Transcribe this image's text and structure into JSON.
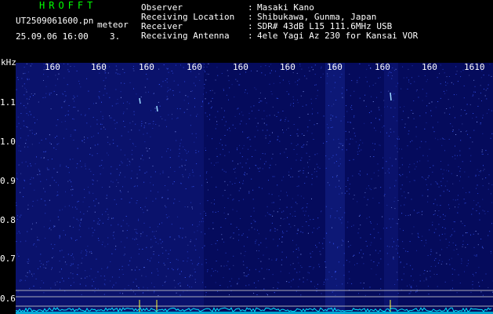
{
  "header": {
    "app_title": "HROFFT",
    "file_name": "UT2509061600.pn",
    "meteor_label": "meteor",
    "date_time": "25.09.06 16:00",
    "count": "3."
  },
  "info": [
    {
      "label": "Observer",
      "value": "Masaki Kano"
    },
    {
      "label": "Receiving Location",
      "value": "Shibukawa, Gunma, Japan"
    },
    {
      "label": "Receiver",
      "value": "SDR# 43dB L15 111.6MHz USB"
    },
    {
      "label": "Receiving Antenna",
      "value": "4ele Yagi Az 230 for Kansai VOR"
    }
  ],
  "info_separator": ":",
  "chart_data": {
    "type": "heatmap",
    "ylabel": "kHz",
    "y_ticks": [
      "1.1",
      "1.0",
      "0.9",
      "0.8",
      "0.7",
      "0.6"
    ],
    "x_ticks": [
      "160",
      "160",
      "160",
      "160",
      "160",
      "160",
      "160",
      "160",
      "160",
      "1610"
    ],
    "background_color": "#050b5c",
    "noise_color": "#3a5cff",
    "trace_color": "#00e5ff",
    "reference_line_color": "#c8c8c8",
    "marker_color": "#ffff33"
  }
}
